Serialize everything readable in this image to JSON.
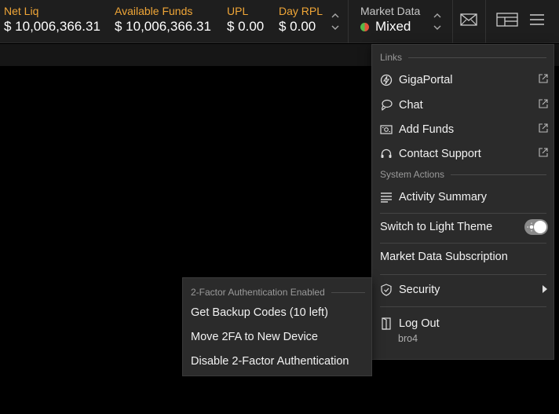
{
  "topbar": {
    "metrics": [
      {
        "label": "Net Liq",
        "value": "$ 10,006,366.31"
      },
      {
        "label": "Available Funds",
        "value": "$ 10,006,366.31"
      },
      {
        "label": "UPL",
        "value": "$ 0.00"
      },
      {
        "label": "Day RPL",
        "value": "$ 0.00"
      }
    ],
    "market_data": {
      "label": "Market Data",
      "value": "Mixed"
    },
    "icons": {
      "mail": "mail-icon",
      "layout": "layout-icon",
      "menu": "hamburger-menu-icon"
    }
  },
  "menu": {
    "links_header": "Links",
    "links": [
      {
        "label": "GigaPortal",
        "icon": "giga-portal-icon"
      },
      {
        "label": "Chat",
        "icon": "chat-icon"
      },
      {
        "label": "Add Funds",
        "icon": "add-funds-icon"
      },
      {
        "label": "Contact Support",
        "icon": "headset-icon"
      }
    ],
    "system_header": "System Actions",
    "activity_summary": "Activity Summary",
    "theme_toggle": "Switch to Light Theme",
    "market_subscription": "Market Data Subscription",
    "security": "Security",
    "logout": "Log Out",
    "username": "bro4"
  },
  "submenu": {
    "header": "2-Factor Authentication Enabled",
    "items": [
      "Get Backup Codes (10 left)",
      "Move 2FA to New Device",
      "Disable 2-Factor Authentication"
    ]
  },
  "colors": {
    "accent_label": "#f0a637",
    "background": "#000000",
    "panel": "#2b2b2b"
  }
}
